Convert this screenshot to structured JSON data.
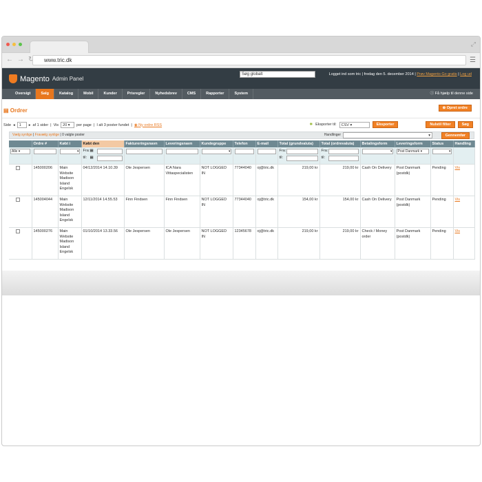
{
  "browser": {
    "url": "www.tric.dk"
  },
  "header": {
    "logo_text": "Magento",
    "logo_sub": "Admin Panel",
    "search_value": "Søg globalt",
    "info": "Logget ind som tric | fredag den 5. december 2014 |",
    "try_link": "Prøv Magento Go gratis",
    "logout": "Log ud"
  },
  "nav": {
    "items": [
      "Oversigt",
      "Salg",
      "Katalog",
      "Mobil",
      "Kunder",
      "Prisregler",
      "Nyhedsbrev",
      "CMS",
      "Rapporter",
      "System"
    ],
    "help": "Få hjælp til denne side"
  },
  "page": {
    "title": "Ordrer",
    "create_button": "Opret ordre"
  },
  "pager": {
    "page_label": "Side",
    "page_value": "1",
    "of_pages": "af 1 sider",
    "view_label": "Vis",
    "per_page_value": "20",
    "per_page_label": "per page",
    "total": "I alt 3 poster fundet",
    "rss": "Ny ordre RSS"
  },
  "export": {
    "label": "Eksporter til:",
    "format": "CSV",
    "export_button": "Eksporter",
    "reset_button": "Nulstil filter",
    "search_button": "Søg"
  },
  "mass": {
    "select_visible": "Vælg synlige",
    "unselect_visible": "Fravælg synlige",
    "selected": "0 valgte poster",
    "actions_label": "Handlinger",
    "submit": "Gennemfør"
  },
  "grid": {
    "headers": [
      "",
      "Ordre #",
      "Købt i",
      "Købt den",
      "Faktureringsnavn",
      "Leveringsnavn",
      "Kundegruppe",
      "Telefon",
      "E-mail",
      "Total (grundvaluta)",
      "Total (ordrevaluta)",
      "Betalingsform",
      "Leveringsform",
      "Status",
      "Handling"
    ],
    "filter": {
      "any": "Alle",
      "from": "Fra:",
      "to": "til:",
      "shipping": "Post Danmark"
    },
    "rows": [
      {
        "order": "145000206",
        "store": "Main Website Madison Island Engelsk",
        "date": "04/12/2014 14.10.39",
        "billing": "Ole Jespersen",
        "shipping_name": "ICA Nara Vittaspecialisten",
        "group": "NOT LOGGED IN",
        "phone": "77344040",
        "email": "oj@tric.dk",
        "total_base": "219,00 kr",
        "total_order": "219,00 kr",
        "payment": "Cash On Delivery",
        "shipping": "Post Danmark (postdk)",
        "status": "Pending",
        "action": "Vis"
      },
      {
        "order": "145004044",
        "store": "Main Website Madison Island Engelsk",
        "date": "12/11/2014 14.55.53",
        "billing": "Finn Findsen",
        "shipping_name": "Finn Findsen",
        "group": "NOT LOGGED IN",
        "phone": "77344040",
        "email": "oj@tric.dk",
        "total_base": "154,00 kr",
        "total_order": "154,00 kr",
        "payment": "Cash On Delivery",
        "shipping": "Post Danmark (postdk)",
        "status": "Pending",
        "action": "Vis"
      },
      {
        "order": "145000276",
        "store": "Main Website Madison Island Engelsk",
        "date": "01/10/2014 13.33.56",
        "billing": "Ole Jespersen",
        "shipping_name": "Ole Jespersen",
        "group": "NOT LOGGED IN",
        "phone": "12345678",
        "email": "oj@tric.dk",
        "total_base": "219,00 kr",
        "total_order": "219,00 kr",
        "payment": "Check / Money order",
        "shipping": "Post Danmark (postdk)",
        "status": "Pending",
        "action": "Vis"
      }
    ]
  },
  "colors": {
    "accent": "#e8771e",
    "header_bg": "#333d44",
    "nav_bg": "#535b61",
    "grid_head": "#6f8992"
  }
}
